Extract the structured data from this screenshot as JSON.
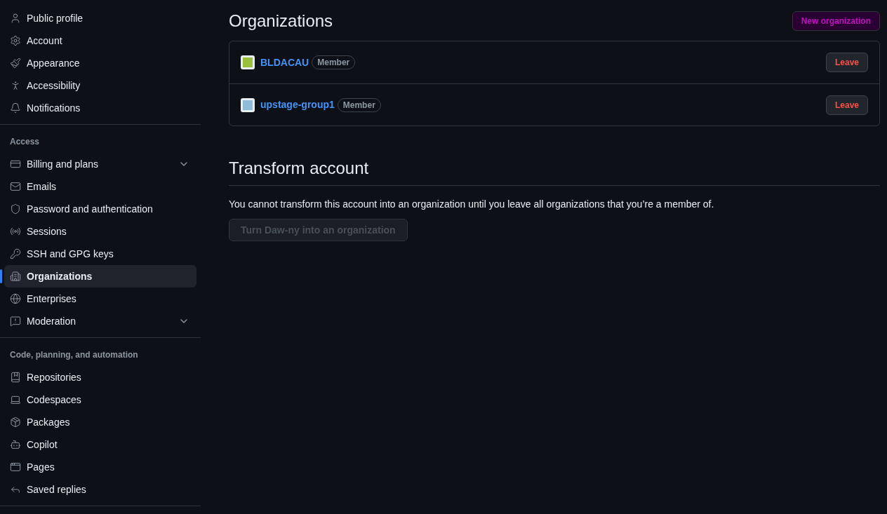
{
  "sidebar": {
    "sections": [
      {
        "items": [
          {
            "label": "Public profile",
            "selected": false
          },
          {
            "label": "Account",
            "selected": false
          },
          {
            "label": "Appearance",
            "selected": false
          },
          {
            "label": "Accessibility",
            "selected": false
          },
          {
            "label": "Notifications",
            "selected": false
          }
        ]
      },
      {
        "heading": "Access",
        "items": [
          {
            "label": "Billing and plans",
            "selected": false,
            "expanded": false
          },
          {
            "label": "Emails",
            "selected": false
          },
          {
            "label": "Password and authentication",
            "selected": false
          },
          {
            "label": "Sessions",
            "selected": false
          },
          {
            "label": "SSH and GPG keys",
            "selected": false
          },
          {
            "label": "Organizations",
            "selected": true
          },
          {
            "label": "Enterprises",
            "selected": false
          },
          {
            "label": "Moderation",
            "selected": false,
            "expanded": false
          }
        ]
      },
      {
        "heading": "Code, planning, and automation",
        "items": [
          {
            "label": "Repositories",
            "selected": false
          },
          {
            "label": "Codespaces",
            "selected": false
          },
          {
            "label": "Packages",
            "selected": false
          },
          {
            "label": "Copilot",
            "selected": false
          },
          {
            "label": "Pages",
            "selected": false
          },
          {
            "label": "Saved replies",
            "selected": false
          }
        ]
      }
    ]
  },
  "organizations": {
    "title": "Organizations",
    "new_button": "New organization",
    "rows": [
      {
        "name": "BLDACAU",
        "badge": "Member",
        "color": "#9bbf3b",
        "action": "Leave"
      },
      {
        "name": "upstage-group1",
        "badge": "Member",
        "color": "#8fbcd8",
        "action": "Leave"
      }
    ]
  },
  "transform": {
    "title": "Transform account",
    "message": "You cannot transform this account into an organization until you leave all organizations that you’re a member of.",
    "button": {
      "label": "Turn Daw-ny into an organization",
      "disabled": true
    }
  }
}
